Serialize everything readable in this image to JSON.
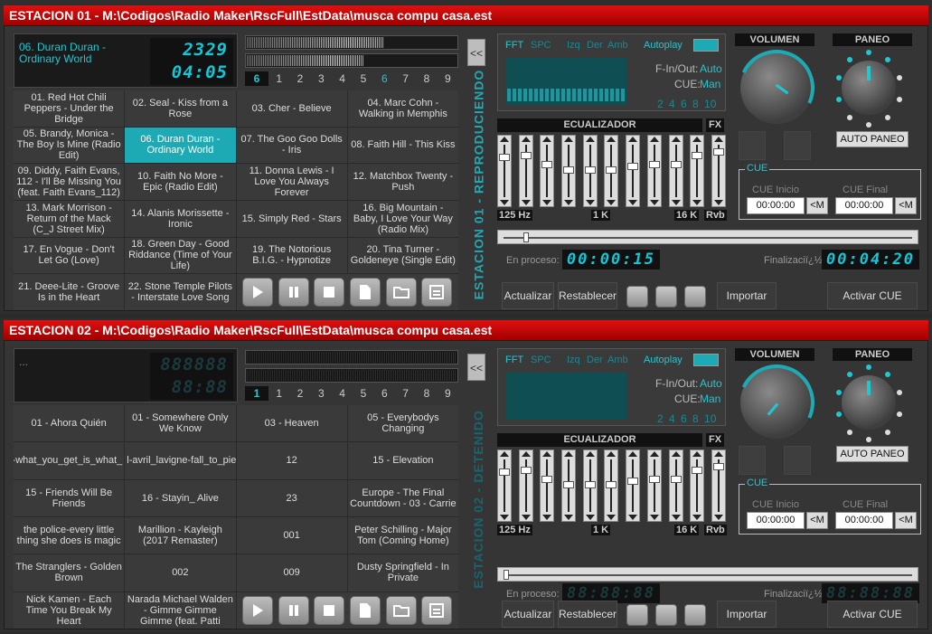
{
  "stations": [
    {
      "title": "ESTACION 01 - M:\\Codigos\\Radio Maker\\RscFull\\EstData\\musca compu casa.est",
      "song": "06. Duran Duran - Ordinary World",
      "lcd_top": "2329",
      "lcd_bottom": "04:05",
      "level_left": 0.65,
      "level_right": 0.55,
      "page_numbers": [
        "6",
        "1",
        "2",
        "3",
        "4",
        "5",
        "6",
        "7",
        "8",
        "9"
      ],
      "status": "ESTACION 01 - REPRODUCIENDO",
      "tracks": [
        "01. Red Hot Chili Peppers - Under the Bridge",
        "02. Seal - Kiss from a Rose",
        "03. Cher - Believe",
        "04. Marc Cohn - Walking in Memphis",
        "05. Brandy, Monica - The Boy Is Mine (Radio Edit)",
        "06. Duran Duran - Ordinary World",
        "07. The Goo Goo Dolls - Iris",
        "08. Faith Hill - This Kiss",
        "09. Diddy, Faith Evans, 112 - I'll Be Missing You (feat. Faith Evans_112)",
        "10. Faith No More - Epic (Radio Edit)",
        "11. Donna Lewis - I Love You Always Forever",
        "12. Matchbox Twenty - Push",
        "13. Mark Morrison - Return of the Mack (C_J Street Mix)",
        "14. Alanis Morissette - Ironic",
        "15. Simply Red - Stars",
        "16. Big Mountain - Baby, I Love Your Way (Radio Mix)",
        "17. En Vogue - Don't Let Go (Love)",
        "18. Green Day - Good Riddance (Time of Your Life)",
        "19. The Notorious B.I.G. - Hypnotize",
        "20. Tina Turner - Goldeneye (Single Edit)",
        "21. Deee-Lite - Groove Is in the Heart",
        "22. Stone Temple Pilots - Interstate Love Song"
      ],
      "elapsed": "00:00:15",
      "remaining": "00:04:20"
    },
    {
      "title": "ESTACION 02 - M:\\Codigos\\Radio Maker\\RscFull\\EstData\\musca compu casa.est",
      "song": "...",
      "lcd_top": "888888",
      "lcd_bottom": "88:88",
      "level_left": 0,
      "level_right": 0,
      "page_numbers": [
        "1",
        "1",
        "2",
        "3",
        "4",
        "5",
        "6",
        "7",
        "8",
        "9"
      ],
      "status": "ESTACION 02 - DETENIDO",
      "tracks": [
        "01 - Ahora Quién",
        "01 - Somewhere Only We Know",
        "03 - Heaven",
        "05 - Everybodys Changing",
        "er-what_you_get_is_what_",
        "l-avril_lavigne-fall_to_piec",
        "12",
        "15 - Elevation",
        "15 - Friends Will Be Friends",
        "16 - Stayin_ Alive",
        "23",
        "Europe - The Final Countdown - 03 - Carrie",
        "the police-every little thing she does is magic",
        "Marillion - Kayleigh (2017 Remaster)",
        "001",
        "Peter Schilling - Major Tom (Coming Home)",
        "The Stranglers - Golden Brown",
        "002",
        "009",
        "Dusty Springfield - In Private",
        "Nick Kamen - Each Time You Break My Heart",
        "Narada Michael Walden - Gimme Gimme Gimme (feat. Patti"
      ],
      "elapsed": "88:88:88",
      "remaining": "88:88:88"
    }
  ],
  "labels": {
    "collapse": "<<",
    "fft": "FFT",
    "spc": "SPC",
    "izq": "Izq",
    "der": "Der",
    "amb": "Amb",
    "autoplay": "Autoplay",
    "fin_out": "F-In/Out:",
    "fin_out_val": "Auto",
    "cue": "CUE:",
    "cue_val": "Man",
    "bands": "2 4 6 8 10",
    "ecualizador": "ECUALIZADOR",
    "fx": "FX",
    "hz125": "125 Hz",
    "k1": "1 K",
    "k16": "16 K",
    "rvb": "Rvb",
    "en_proceso": "En proceso:",
    "finalizacion": "Finalizaciï¿½n",
    "actualizar": "Actualizar",
    "restablecer": "Restablecer",
    "importar": "Importar",
    "activar_cue": "Activar CUE",
    "volumen": "VOLUMEN",
    "paneo": "PANEO",
    "auto_paneo": "AUTO PANEO",
    "cue_legend": "CUE",
    "cue_inicio": "CUE Inicio",
    "cue_final": "CUE Final",
    "cue_time": "00:00:00",
    "cue_btn": "<M"
  },
  "colors": {
    "accent": "#1ec8d2",
    "title_bar": "#d00000",
    "selected_cell": "#1eaab4"
  }
}
